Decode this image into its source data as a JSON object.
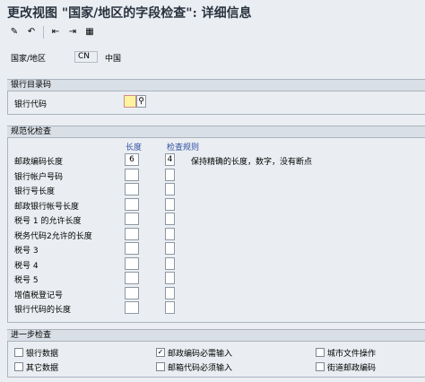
{
  "window": {
    "title": "更改视图 \"国家/地区的字段检查\": 详细信息"
  },
  "toolbar": {
    "icons": [
      "display-change-icon",
      "undo-icon",
      "previous-entry-icon",
      "next-entry-icon",
      "other-entry-icon"
    ],
    "glyphs": [
      "✎",
      "↶",
      "⇤",
      "⇥",
      "▦"
    ]
  },
  "country": {
    "label": "国家/地区",
    "code": "CN",
    "name": "中国"
  },
  "bank_section": {
    "title": "银行目录码",
    "bank_code_label": "银行代码"
  },
  "check_section": {
    "title": "规范化检查",
    "col_length": "长度",
    "col_rule": "检查规则",
    "rows": [
      {
        "label": "邮政编码长度",
        "length": "6",
        "rule": "4",
        "rule_text": "保持精确的长度，数字，没有断点"
      },
      {
        "label": "银行帐户号码",
        "length": "",
        "rule": "",
        "rule_text": ""
      },
      {
        "label": "银行号长度",
        "length": "",
        "rule": "",
        "rule_text": ""
      },
      {
        "label": "邮政银行帐号长度",
        "length": "",
        "rule": "",
        "rule_text": ""
      },
      {
        "label": "税号 1 的允许长度",
        "length": "",
        "rule": "",
        "rule_text": ""
      },
      {
        "label": "税务代码2允许的长度",
        "length": "",
        "rule": "",
        "rule_text": ""
      },
      {
        "label": "税号 3",
        "length": "",
        "rule": "",
        "rule_text": ""
      },
      {
        "label": "税号 4",
        "length": "",
        "rule": "",
        "rule_text": ""
      },
      {
        "label": "税号 5",
        "length": "",
        "rule": "",
        "rule_text": ""
      },
      {
        "label": "增值税登记号",
        "length": "",
        "rule": "",
        "rule_text": ""
      },
      {
        "label": "银行代码的长度",
        "length": "",
        "rule": "",
        "rule_text": ""
      }
    ]
  },
  "further_section": {
    "title": "进一步检查",
    "checks": [
      {
        "label": "银行数据",
        "checked": false
      },
      {
        "label": "其它数据",
        "checked": false
      },
      {
        "label": "邮政编码必需输入",
        "checked": true
      },
      {
        "label": "邮箱代码必须输入",
        "checked": false
      },
      {
        "label": "城市文件操作",
        "checked": false
      },
      {
        "label": "街道邮政编码",
        "checked": false
      }
    ]
  }
}
